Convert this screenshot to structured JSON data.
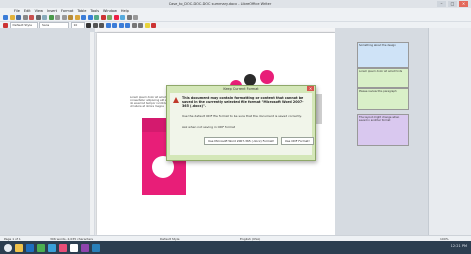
{
  "window": {
    "title": "Case_to_DOC-DOC-DOC summary.docx - LibreOffice Writer"
  },
  "menubar": {
    "items": [
      "File",
      "Edit",
      "View",
      "Insert",
      "Format",
      "Table",
      "Tools",
      "Window",
      "Help"
    ]
  },
  "formatting": {
    "paragraph_style": "Default Style",
    "font_name": "Sans",
    "font_size": "10"
  },
  "document": {
    "text_block": "Lorem ipsum dolor sit amet consectetur adipiscing elit sed do eiusmod tempor incididunt ut labore et dolore magna",
    "card_color": "#e81e78"
  },
  "comments": [
    {
      "text": "Something about the design",
      "color": "#cfe3f7"
    },
    {
      "text": "Lorem ipsum dolor sit amet fonts",
      "color": "#d9f0c8"
    },
    {
      "text": "Please review this paragraph",
      "color": "#d9f0c8"
    },
    {
      "text": "The layout might change when saved in another format",
      "color": "#d9c8ef"
    }
  ],
  "dialog": {
    "title": "Keep Current Format",
    "message": "This document may contain formatting or content that cannot be saved in the currently selected file format \"Microsoft Word 2007-365 (.docx)\".",
    "question": "Use the default ODF file format to be sure that the document is saved correctly.",
    "tip": "Ask when not saving in ODF format",
    "btn_keep": "Use Microsoft Word 2007-365 (.docx) Format!",
    "btn_odf": "Use ODF Format!"
  },
  "statusbar": {
    "page": "Page 1 of 1",
    "words": "306 words, 2,035 characters",
    "style": "Default Style",
    "language": "English (USA)",
    "zoom": "100%"
  },
  "taskbar": {
    "time": "12:21 PM"
  }
}
